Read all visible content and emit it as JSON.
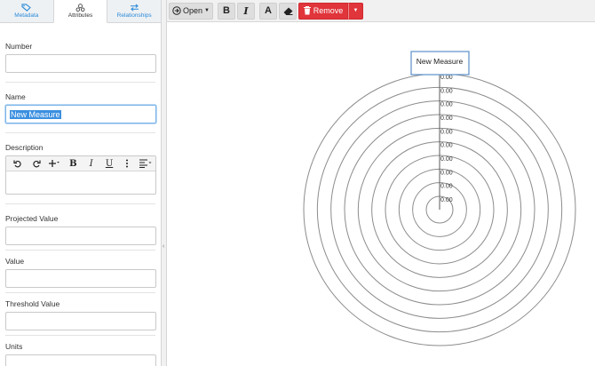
{
  "tabs": [
    {
      "label": "Metadata",
      "icon": "tag-icon"
    },
    {
      "label": "Attributes",
      "icon": "shapes-icon"
    },
    {
      "label": "Relationships",
      "icon": "swap-arrows-icon"
    }
  ],
  "form": {
    "number": {
      "label": "Number",
      "value": ""
    },
    "name": {
      "label": "Name",
      "value": "New Measure"
    },
    "description": {
      "label": "Description",
      "value": ""
    },
    "projected_value": {
      "label": "Projected Value",
      "value": ""
    },
    "value": {
      "label": "Value",
      "value": ""
    },
    "threshold_value": {
      "label": "Threshold Value",
      "value": ""
    },
    "units": {
      "label": "Units",
      "value": ""
    }
  },
  "editor_toolbar": {
    "bold": "B",
    "italic": "I",
    "underline": "U"
  },
  "toolbar": {
    "open_label": "Open",
    "bold": "B",
    "italic": "I",
    "text_color": "A",
    "remove_label": "Remove"
  },
  "diagram": {
    "node_label": "New Measure",
    "ring_labels": [
      "0.00",
      "0.00",
      "0.00",
      "0.00",
      "0.00",
      "0.00",
      "0.00",
      "0.00",
      "0.00",
      "0.00"
    ]
  },
  "colors": {
    "accent": "#2a8ad8",
    "danger": "#e0353b",
    "ring": "#8c8c8c",
    "node_border": "#5a8fc8"
  }
}
